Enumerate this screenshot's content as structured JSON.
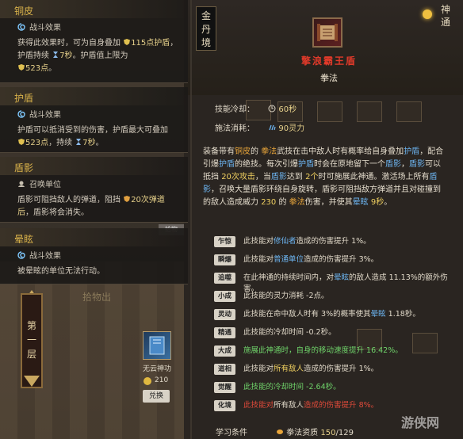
{
  "panels": [
    {
      "title": "铜皮",
      "sub_icon": "swirl-icon",
      "sub_label": "战斗效果",
      "body_parts": [
        "获得此效果时，可为自身叠加 ",
        "115点护盾",
        "，护盾持续 ",
        "7秒",
        "。护盾值上限为 ",
        "523点",
        "。"
      ]
    },
    {
      "title": "护盾",
      "sub_icon": "swirl-icon",
      "sub_label": "战斗效果",
      "body_parts": [
        "护盾可以抵消受到的伤害，护盾最大可叠加 ",
        "523点",
        "，持续 ",
        "7秒",
        "。"
      ]
    },
    {
      "title": "盾影",
      "sub_icon": "summon-icon",
      "sub_label": "召唤单位",
      "body_parts": [
        "盾影可阻挡敌人的弹道，阻挡 ",
        "20次弹道后",
        "，盾影将会消失。"
      ]
    },
    {
      "title": "晕眩",
      "sub_icon": "swirl-icon",
      "sub_label": "战斗效果",
      "body_parts": [
        "被晕眩的单位无法行动。"
      ]
    }
  ],
  "realm": "金丹境",
  "skill": {
    "name": "擎浪霸王盾",
    "type": "拳法",
    "cooldown_label": "技能冷却：",
    "cooldown_value": "60秒",
    "cost_label": "施法消耗：",
    "cost_value": "90灵力"
  },
  "description": [
    {
      "t": "装备带有",
      "c": ""
    },
    {
      "t": "铜皮",
      "c": "o"
    },
    {
      "t": "的 ",
      "c": ""
    },
    {
      "t": "拳法",
      "c": "o"
    },
    {
      "t": "武技在击中敌人时有概率给自身叠加",
      "c": ""
    },
    {
      "t": "护盾",
      "c": "b"
    },
    {
      "t": "，配合引爆",
      "c": ""
    },
    {
      "t": "护盾",
      "c": "b"
    },
    {
      "t": "的绝技。每次引爆",
      "c": ""
    },
    {
      "t": "护盾",
      "c": "b"
    },
    {
      "t": "时会在原地留下一个",
      "c": ""
    },
    {
      "t": "盾影",
      "c": "b"
    },
    {
      "t": "，",
      "c": ""
    },
    {
      "t": "盾影",
      "c": "b"
    },
    {
      "t": "可以抵挡 ",
      "c": ""
    },
    {
      "t": "20次攻击",
      "c": "y"
    },
    {
      "t": "，当",
      "c": ""
    },
    {
      "t": "盾影",
      "c": "b"
    },
    {
      "t": "达到 ",
      "c": ""
    },
    {
      "t": "2个",
      "c": "y"
    },
    {
      "t": "时可施展此神通。激活场上所有",
      "c": ""
    },
    {
      "t": "盾影",
      "c": "b"
    },
    {
      "t": "，召唤大量盾影环绕自身旋转，盾影可阻挡敌方弹道并且对碰撞到的敌人造成威力 ",
      "c": ""
    },
    {
      "t": "230",
      "c": "y"
    },
    {
      "t": " 的 ",
      "c": ""
    },
    {
      "t": "拳法",
      "c": "o"
    },
    {
      "t": "伤害，并使其",
      "c": ""
    },
    {
      "t": "晕眩",
      "c": "b"
    },
    {
      "t": " ",
      "c": ""
    },
    {
      "t": "9秒",
      "c": "y"
    },
    {
      "t": "。",
      "c": ""
    }
  ],
  "modifiers": [
    {
      "tag": "乍惊",
      "parts": [
        {
          "t": "此技能对",
          "c": ""
        },
        {
          "t": "修仙者",
          "c": "b"
        },
        {
          "t": "造成的伤害提升 ",
          "c": ""
        },
        {
          "t": "1%",
          "c": ""
        },
        {
          "t": "。",
          "c": ""
        }
      ]
    },
    {
      "tag": "瞬爆",
      "parts": [
        {
          "t": "此技能对",
          "c": ""
        },
        {
          "t": "普通单位",
          "c": "b"
        },
        {
          "t": "造成的伤害提升 ",
          "c": ""
        },
        {
          "t": "3%",
          "c": ""
        },
        {
          "t": "。",
          "c": ""
        }
      ]
    },
    {
      "tag": "追噬",
      "parts": [
        {
          "t": "在此神通的持续时间内，对",
          "c": ""
        },
        {
          "t": "晕眩",
          "c": "b"
        },
        {
          "t": "的敌人造成 ",
          "c": ""
        },
        {
          "t": "11.13%",
          "c": ""
        },
        {
          "t": "的额外伤害。",
          "c": ""
        }
      ]
    },
    {
      "tag": "小成",
      "parts": [
        {
          "t": "此技能的灵力消耗 ",
          "c": ""
        },
        {
          "t": "-2点",
          "c": ""
        },
        {
          "t": "。",
          "c": ""
        }
      ]
    },
    {
      "tag": "灵动",
      "parts": [
        {
          "t": "此技能在命中敌人时有 ",
          "c": ""
        },
        {
          "t": "3%",
          "c": ""
        },
        {
          "t": "的概率使其",
          "c": ""
        },
        {
          "t": "晕眩",
          "c": "b"
        },
        {
          "t": " ",
          "c": ""
        },
        {
          "t": "1.18秒",
          "c": ""
        },
        {
          "t": "。",
          "c": ""
        }
      ]
    },
    {
      "tag": "精通",
      "parts": [
        {
          "t": "此技能的冷却时间 ",
          "c": ""
        },
        {
          "t": "-0.2秒",
          "c": ""
        },
        {
          "t": "。",
          "c": ""
        }
      ]
    },
    {
      "tag": "大成",
      "parts": [
        {
          "t": "施展此神通时，自身的移动速度提升 ",
          "c": "green"
        },
        {
          "t": "16.42%",
          "c": "green"
        },
        {
          "t": "。",
          "c": "green"
        }
      ]
    },
    {
      "tag": "道相",
      "parts": [
        {
          "t": "此技能对",
          "c": ""
        },
        {
          "t": "所有敌人",
          "c": "y"
        },
        {
          "t": "造成的伤害提升 ",
          "c": ""
        },
        {
          "t": "1%",
          "c": ""
        },
        {
          "t": "。",
          "c": ""
        }
      ]
    },
    {
      "tag": "觉醒",
      "parts": [
        {
          "t": "此技能的冷却时间 ",
          "c": "green"
        },
        {
          "t": "-2.64秒",
          "c": "green"
        },
        {
          "t": "。",
          "c": "green"
        }
      ]
    },
    {
      "tag": "化境",
      "parts": [
        {
          "t": "此技能对",
          "c": "red"
        },
        {
          "t": "所有敌人",
          "c": ""
        },
        {
          "t": "造成的伤害提升 ",
          "c": "red"
        },
        {
          "t": "8%",
          "c": "red"
        },
        {
          "t": "。",
          "c": "red"
        }
      ]
    }
  ],
  "learn": {
    "label": "学习条件",
    "req_name": "拳法资质",
    "current": "150",
    "required": "/129"
  },
  "floor": {
    "label": "第一层"
  },
  "item": {
    "name": "无云神功",
    "price": "210",
    "redeem_label": "兑换"
  },
  "top_right": {
    "label": "神通"
  },
  "misc": {
    "blank_button": "拾物",
    "floor_sign": "拾物出",
    "watermark": "游侠网"
  },
  "colors": {
    "gold": "#d9b24a",
    "skill_red": "#e23a2a",
    "blue": "#6cb4f0",
    "orange": "#e8a53a",
    "yellow": "#f0d060",
    "green": "#6fd36a"
  }
}
